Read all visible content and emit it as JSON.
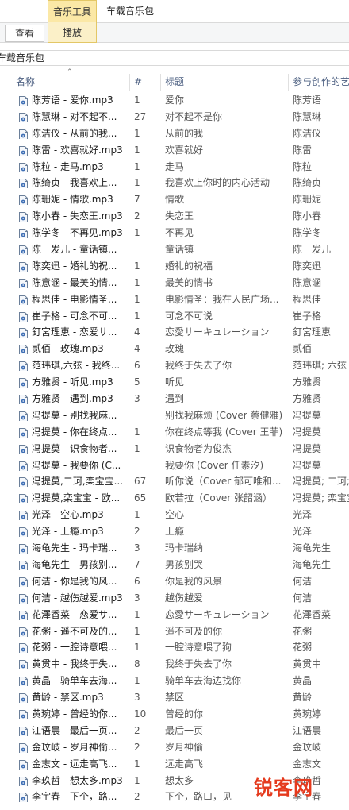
{
  "ribbon": {
    "context_tab": "音乐工具",
    "window_title": "车载音乐包",
    "tab_view": "查看",
    "tab_play": "播放"
  },
  "address": {
    "path": "车载音乐包"
  },
  "columns": {
    "name": "名称",
    "number": "#",
    "title": "标题",
    "artist": "参与创作的艺"
  },
  "icon_name": "audio-file-icon",
  "rows": [
    {
      "name": "陈芳语 - 爱你.mp3",
      "num": "1",
      "title": "爱你",
      "artist": "陈芳语"
    },
    {
      "name": "陈慧琳 - 对不起不...",
      "num": "27",
      "title": "对不起不是你",
      "artist": "陈慧琳"
    },
    {
      "name": "陈洁仪 - 从前的我...",
      "num": "1",
      "title": "从前的我",
      "artist": "陈洁仪"
    },
    {
      "name": "陈雷 - 欢喜就好.mp3",
      "num": "1",
      "title": "欢喜就好",
      "artist": "陈雷"
    },
    {
      "name": "陈粒 - 走马.mp3",
      "num": "1",
      "title": "走马",
      "artist": "陈粒"
    },
    {
      "name": "陈绮贞 - 我喜欢上...",
      "num": "1",
      "title": "我喜欢上你时的内心活动",
      "artist": "陈绮贞"
    },
    {
      "name": "陈珊妮 - 情歌.mp3",
      "num": "7",
      "title": "情歌",
      "artist": "陈珊妮"
    },
    {
      "name": "陈小春 - 失恋王.mp3",
      "num": "2",
      "title": "失恋王",
      "artist": "陈小春"
    },
    {
      "name": "陈学冬 - 不再见.mp3",
      "num": "1",
      "title": "不再见",
      "artist": "陈学冬"
    },
    {
      "name": "陈一发儿 - 童话镇...",
      "num": "",
      "title": "童话镇",
      "artist": "陈一发儿"
    },
    {
      "name": "陈奕迅 - 婚礼的祝...",
      "num": "1",
      "title": "婚礼的祝福",
      "artist": "陈奕迅"
    },
    {
      "name": "陈意涵 - 最美的情...",
      "num": "1",
      "title": "最美的情书",
      "artist": "陈意涵"
    },
    {
      "name": "程思佳 - 电影情圣...",
      "num": "1",
      "title": "电影情圣：我在人民广场...",
      "artist": "程思佳"
    },
    {
      "name": "崔子格 - 可念不可...",
      "num": "1",
      "title": "可念不可说",
      "artist": "崔子格"
    },
    {
      "name": "釘宮理恵 - 恋爱サ...",
      "num": "4",
      "title": "恋愛サーキュレーション",
      "artist": "釘宮理恵"
    },
    {
      "name": "贰佰 - 玫瑰.mp3",
      "num": "4",
      "title": "玫瑰",
      "artist": "贰佰"
    },
    {
      "name": "范玮琪,六弦 - 我终...",
      "num": "6",
      "title": "我终于失去了你",
      "artist": "范玮琪; 六弦"
    },
    {
      "name": "方雅贤 - 听见.mp3",
      "num": "5",
      "title": "听见",
      "artist": "方雅贤"
    },
    {
      "name": "方雅贤 - 遇到.mp3",
      "num": "3",
      "title": "遇到",
      "artist": "方雅贤"
    },
    {
      "name": "冯提莫 - 别找我麻...",
      "num": "",
      "title": "别找我麻烦 (Cover 蔡健雅)",
      "artist": "冯提莫"
    },
    {
      "name": "冯提莫 - 你在终点...",
      "num": "1",
      "title": "你在终点等我 (Cover 王菲)",
      "artist": "冯提莫"
    },
    {
      "name": "冯提莫 - 识食物者...",
      "num": "1",
      "title": "识食物者为俊杰",
      "artist": "冯提莫"
    },
    {
      "name": "冯提莫 - 我要你 (C...",
      "num": "",
      "title": "我要你 (Cover 任素汐)",
      "artist": "冯提莫"
    },
    {
      "name": "冯提莫,二珂,栾宝宝...",
      "num": "67",
      "title": "听你说（Cover 郁可唯和...",
      "artist": "冯提莫; 二珂;"
    },
    {
      "name": "冯提莫,栾宝宝 - 欧...",
      "num": "65",
      "title": "欧若拉（Cover 张韶涵）",
      "artist": "冯提莫; 栾宝宝"
    },
    {
      "name": "光泽 - 空心.mp3",
      "num": "1",
      "title": "空心",
      "artist": "光泽"
    },
    {
      "name": "光泽 - 上瘾.mp3",
      "num": "2",
      "title": "上瘾",
      "artist": "光泽"
    },
    {
      "name": "海龟先生 - 玛卡瑞...",
      "num": "3",
      "title": "玛卡瑞纳",
      "artist": "海龟先生"
    },
    {
      "name": "海龟先生 - 男孩别...",
      "num": "7",
      "title": "男孩别哭",
      "artist": "海龟先生"
    },
    {
      "name": "何洁 - 你是我的风...",
      "num": "6",
      "title": "你是我的风景",
      "artist": "何洁"
    },
    {
      "name": "何洁 - 越伤越爱.mp3",
      "num": "3",
      "title": "越伤越爱",
      "artist": "何洁"
    },
    {
      "name": "花澤香菜 - 恋爱サ...",
      "num": "1",
      "title": "恋愛サーキュレーション",
      "artist": "花澤香菜"
    },
    {
      "name": "花粥 - 遥不可及的...",
      "num": "1",
      "title": "遥不可及的你",
      "artist": "花粥"
    },
    {
      "name": "花粥 - 一腔诗意喂...",
      "num": "1",
      "title": "一腔诗意喂了狗",
      "artist": "花粥"
    },
    {
      "name": "黄贯中 - 我终于失...",
      "num": "8",
      "title": "我终于失去了你",
      "artist": "黄贯中"
    },
    {
      "name": "黄晶 - 骑单车去海...",
      "num": "1",
      "title": "骑单车去海边找你",
      "artist": "黄晶"
    },
    {
      "name": "黄龄 - 禁区.mp3",
      "num": "3",
      "title": "禁区",
      "artist": "黄龄"
    },
    {
      "name": "黄琬婷 - 曾经的你...",
      "num": "10",
      "title": "曾经的你",
      "artist": "黄琬婷"
    },
    {
      "name": "江语晨 - 最后一页...",
      "num": "2",
      "title": "最后一页",
      "artist": "江语晨"
    },
    {
      "name": "金玟岐 - 岁月神偷...",
      "num": "2",
      "title": "岁月神偷",
      "artist": "金玟岐"
    },
    {
      "name": "金志文 - 远走高飞...",
      "num": "1",
      "title": "远走高飞",
      "artist": "金志文"
    },
    {
      "name": "李玖哲 - 想太多.mp3",
      "num": "1",
      "title": "想太多",
      "artist": "李玖哲"
    },
    {
      "name": "李宇春 - 下个，路...",
      "num": "2",
      "title": "下个，路口，见",
      "artist": "李宇春"
    }
  ],
  "watermark": "锐客网"
}
